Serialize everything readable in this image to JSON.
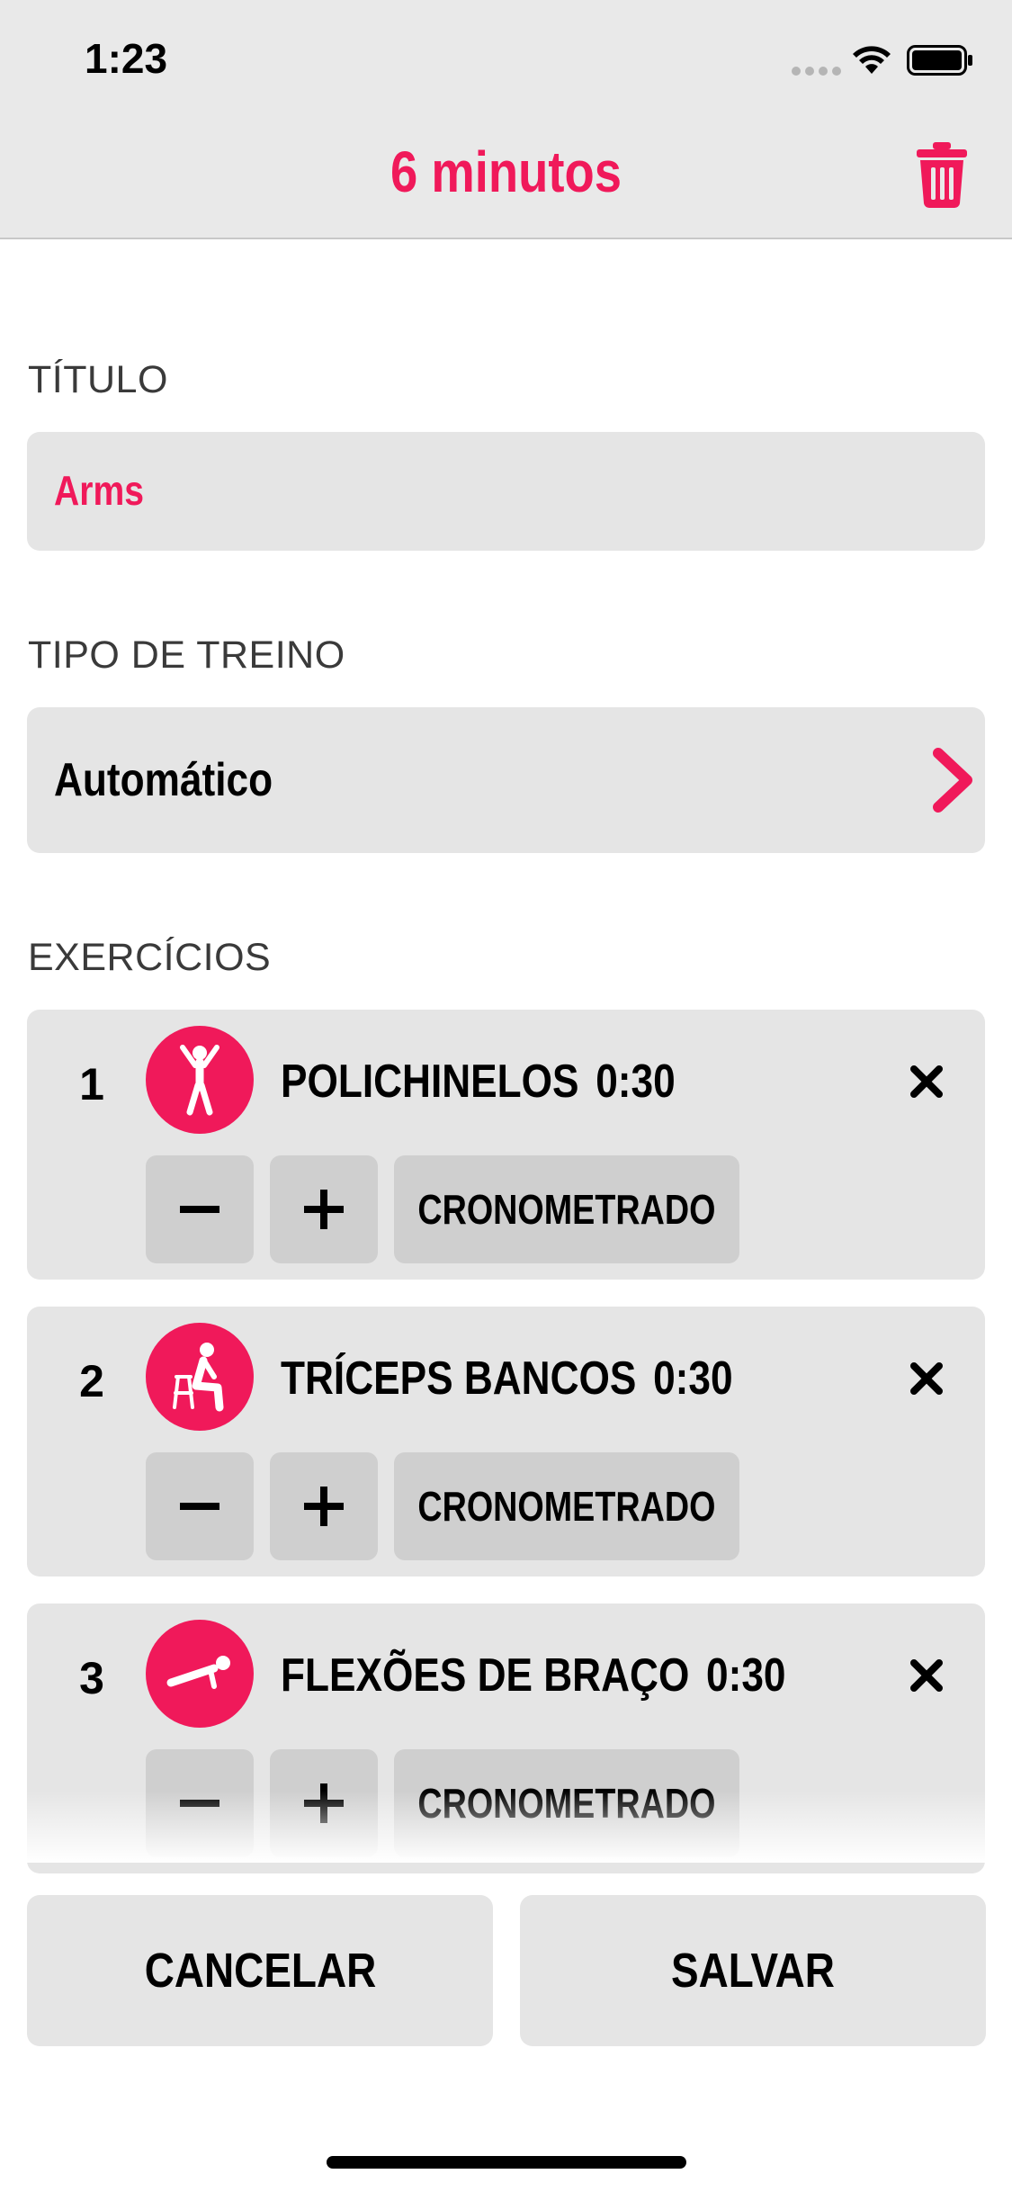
{
  "status": {
    "time": "1:23"
  },
  "nav": {
    "title": "6 minutos"
  },
  "title_section": {
    "label": "TÍTULO",
    "value": "Arms"
  },
  "type_section": {
    "label": "TIPO DE TREINO",
    "value": "Automático"
  },
  "exercises_section": {
    "label": "EXERCÍCIOS",
    "items": [
      {
        "number": "1",
        "name": "POLICHINELOS",
        "duration": "0:30",
        "mode": "CRONOMETRADO",
        "icon": "jumping-jacks-icon"
      },
      {
        "number": "2",
        "name": "TRÍCEPS BANCOS",
        "duration": "0:30",
        "mode": "CRONOMETRADO",
        "icon": "triceps-dips-icon"
      },
      {
        "number": "3",
        "name": "FLEXÕES DE BRAÇO",
        "duration": "0:30",
        "mode": "CRONOMETRADO",
        "icon": "push-up-icon"
      }
    ]
  },
  "actions": {
    "cancel": "CANCELAR",
    "save": "SALVAR"
  },
  "colors": {
    "accent": "#f0195a",
    "panel": "#e5e5e5",
    "control": "#cfcfcf",
    "bar": "#e9e9e9"
  }
}
